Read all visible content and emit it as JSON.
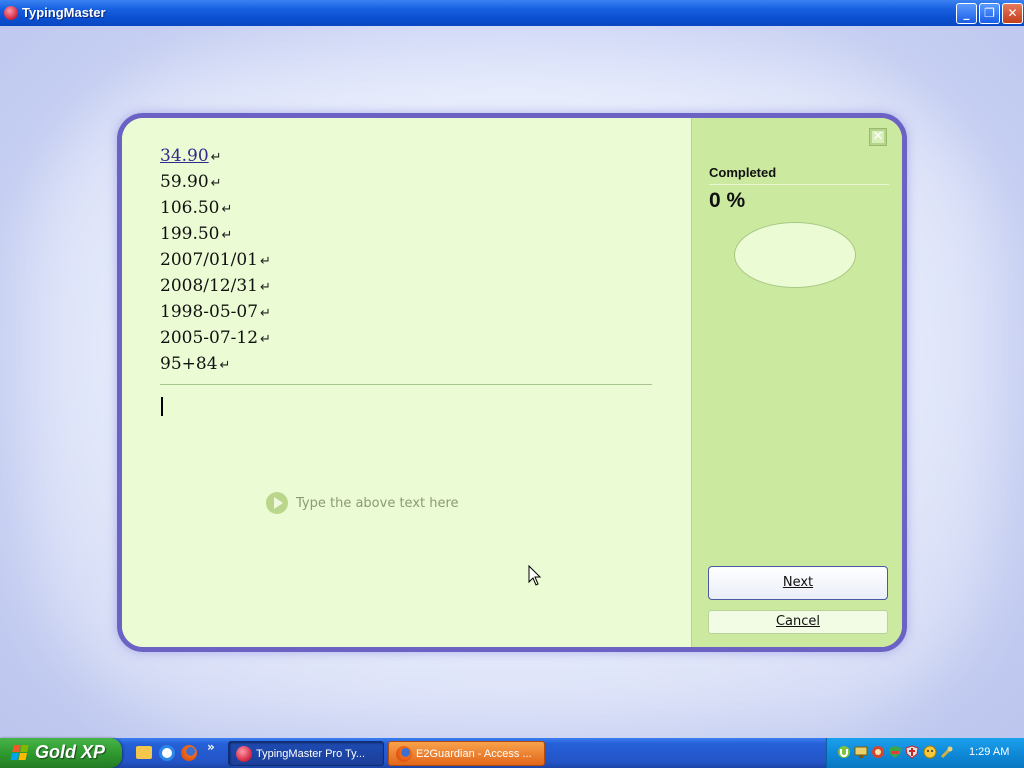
{
  "window": {
    "title": "TypingMaster",
    "minimize_glyph": "_",
    "maximize_glyph": "❐",
    "close_glyph": "✕"
  },
  "exercise": {
    "lines": [
      {
        "text": "34.90",
        "current": true
      },
      {
        "text": "59.90"
      },
      {
        "text": "106.50"
      },
      {
        "text": "199.50"
      },
      {
        "text": "2007/01/01"
      },
      {
        "text": "2008/12/31"
      },
      {
        "text": "1998-05-07"
      },
      {
        "text": "2005-07-12"
      },
      {
        "text": "95+84"
      }
    ],
    "return_glyph": "↵",
    "hint": "Type the above text here",
    "hint_icon": "play-icon"
  },
  "progress": {
    "label": "Completed",
    "value_text": "0 %",
    "fraction": 0,
    "close_glyph": "✕"
  },
  "buttons": {
    "next": {
      "label": "Next"
    },
    "cancel": {
      "label": "Cancel"
    }
  },
  "taskbar": {
    "start_label": "Gold XP",
    "more_glyph": "»",
    "tasks": [
      {
        "label": "TypingMaster Pro Ty...",
        "active": true
      },
      {
        "label": "E2Guardian - Access ...",
        "active": false
      }
    ],
    "clock": "1:29 AM"
  },
  "colors": {
    "card_border": "#6b62c4",
    "left_pane": "#ebfbd3",
    "right_pane": "#cbeaa0",
    "current_text": "#33288f"
  }
}
